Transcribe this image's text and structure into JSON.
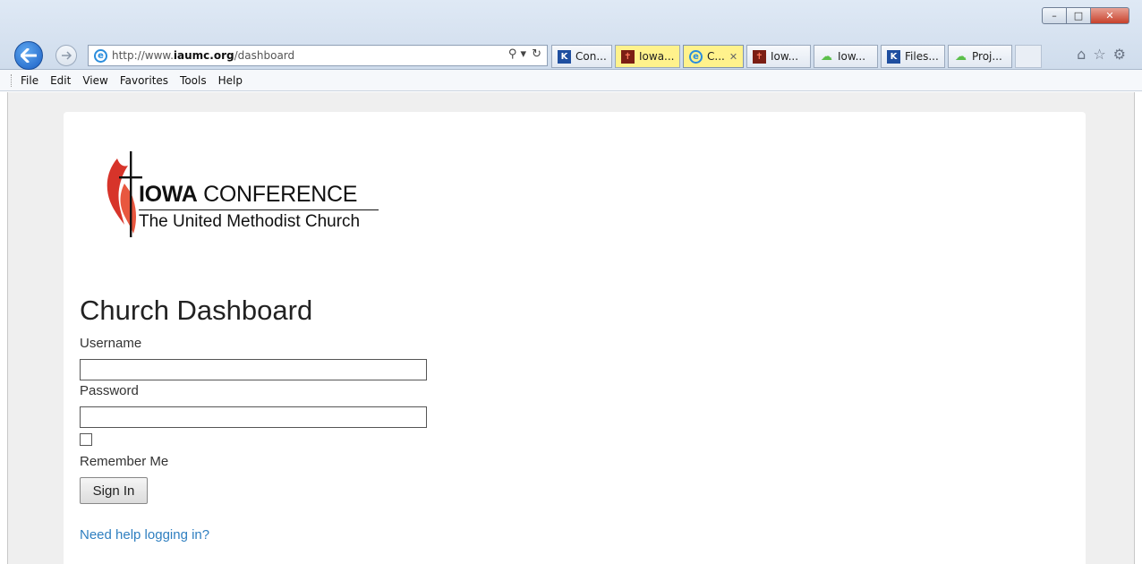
{
  "window": {
    "controls": {
      "minimize": "–",
      "maximize": "□",
      "close": "✕"
    }
  },
  "navigation": {
    "back_icon": "back-arrow-icon",
    "forward_icon": "forward-arrow-icon",
    "address": {
      "prefix": "http://www.",
      "domain": "iaumc.org",
      "path": "/dashboard"
    },
    "address_tools": {
      "search": "⚲ ▾",
      "refresh": "↻"
    }
  },
  "tabs": [
    {
      "label": "Con...",
      "icon": "k-icon",
      "state": "normal"
    },
    {
      "label": "Iowa...",
      "icon": "cross-flame-icon",
      "state": "highlight"
    },
    {
      "label": "C...",
      "icon": "ie-icon",
      "state": "active",
      "close": "✕"
    },
    {
      "label": "Iow...",
      "icon": "cross-flame-icon",
      "state": "normal"
    },
    {
      "label": "Iow...",
      "icon": "cloud-icon",
      "state": "normal"
    },
    {
      "label": "Files...",
      "icon": "k-icon",
      "state": "normal"
    },
    {
      "label": "Proj...",
      "icon": "cloud-icon",
      "state": "normal"
    }
  ],
  "chrome_icons": {
    "home": "⌂",
    "favorites": "☆",
    "settings": "⚙"
  },
  "menubar": {
    "items": [
      "File",
      "Edit",
      "View",
      "Favorites",
      "Tools",
      "Help"
    ]
  },
  "logo": {
    "line1_strong": "IOWA",
    "line1_rest": " CONFERENCE",
    "line2": "The United Methodist Church"
  },
  "login": {
    "title": "Church Dashboard",
    "username_label": "Username",
    "username_value": "",
    "password_label": "Password",
    "password_value": "",
    "remember_label": "Remember Me",
    "remember_checked": false,
    "signin_label": "Sign In",
    "help_link": "Need help logging in?"
  },
  "colors": {
    "link": "#2f7fc0",
    "logo_red": "#d7342a",
    "page_bg": "#efefef",
    "highlight_tab": "#fff28c"
  }
}
